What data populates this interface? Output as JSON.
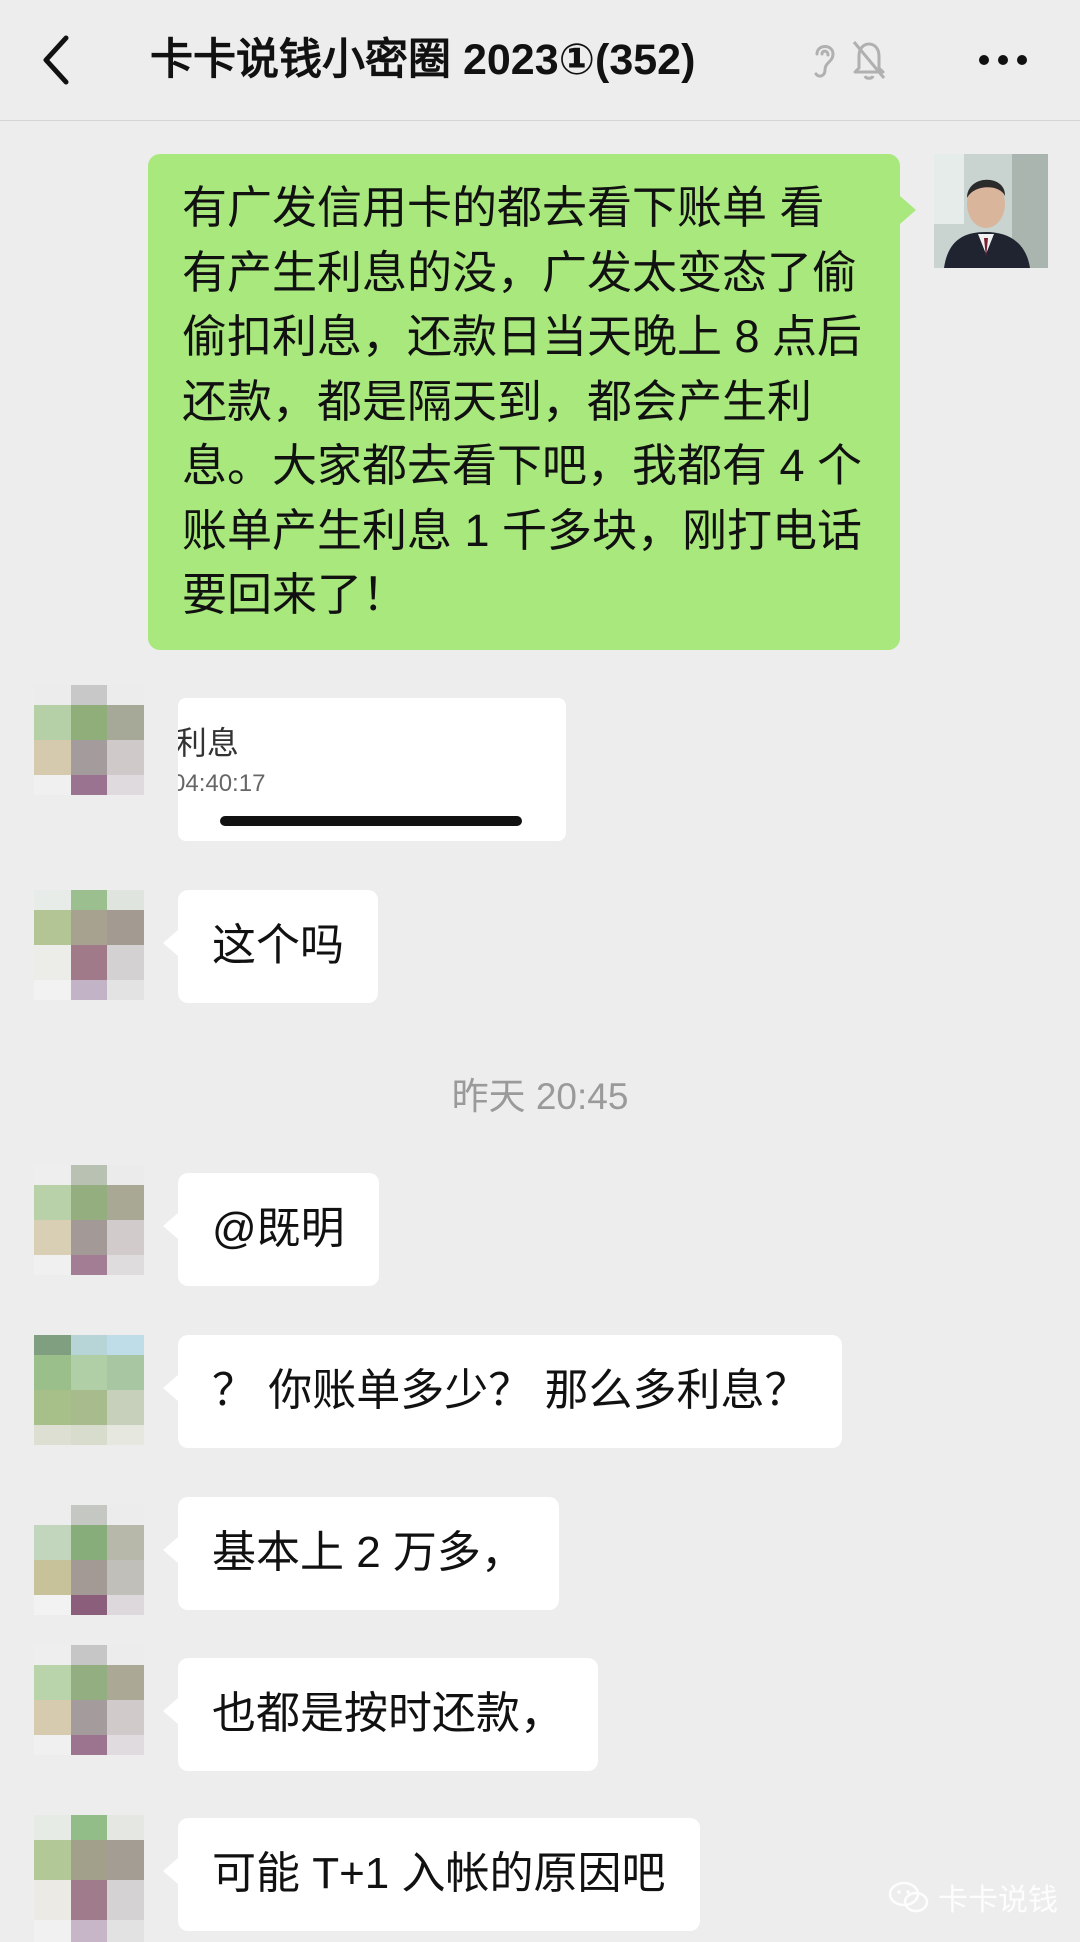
{
  "header": {
    "title": "卡卡说钱小密圈 2023①(352)",
    "icons": [
      "back-chevron-icon",
      "ear-icon",
      "mute-bell-icon",
      "more-icon"
    ]
  },
  "messages": {
    "m1": "有广发信用卡的都去看下账单 看有产生利息的没，广发太变态了偷偷扣利息，还款日当天晚上 8 点后还款，都是隔天到，都会产生利息。大家都去看下吧，我都有 4 个账单产生利息 1 千多块，刚打电话要回来了！",
    "quote_text": "t利息",
    "quote_time": "04:40:17",
    "m2": "这个吗",
    "m3": "@既明",
    "m4": "？ 你账单多少？ 那么多利息？",
    "m5": "基本上 2 万多，",
    "m6": "也都是按时还款，",
    "m7": "可能 T+1 入帐的原因吧"
  },
  "timestamp": "昨天 20:45",
  "watermark": "卡卡说钱",
  "colors": {
    "background": "#ededed",
    "self_bubble": "#a9e87d",
    "other_bubble": "#ffffff",
    "timestamp": "#9a9a9a"
  }
}
